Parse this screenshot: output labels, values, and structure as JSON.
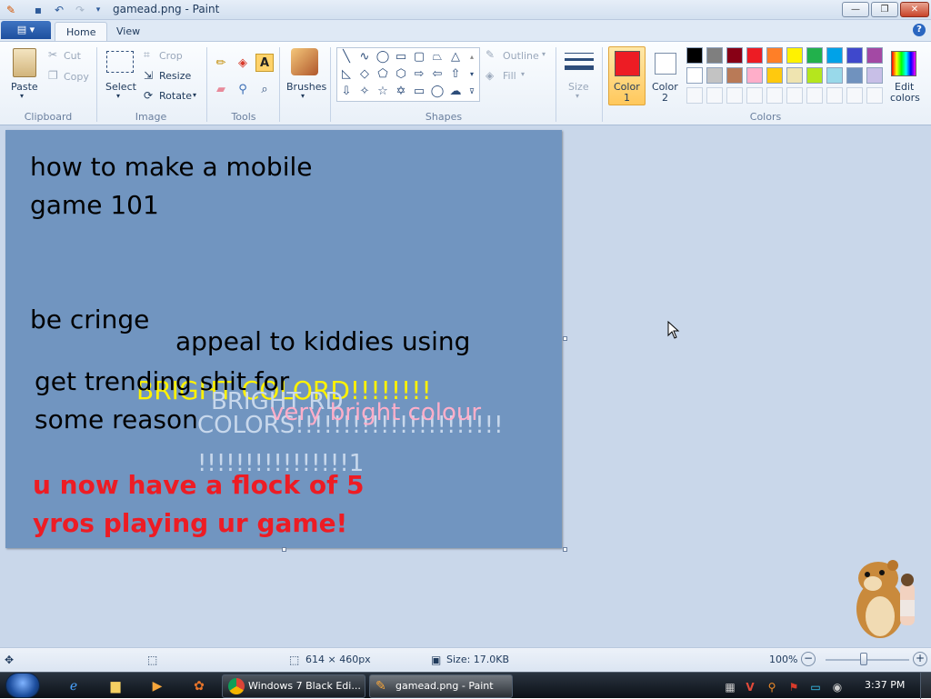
{
  "window": {
    "title": "gamead.png - Paint"
  },
  "quick_access": {
    "save_icon": "save-icon",
    "undo_icon": "undo-icon",
    "redo_icon": "redo-icon"
  },
  "window_buttons": {
    "minimize": "—",
    "maximize": "❐",
    "close": "✕"
  },
  "tabs": [
    {
      "label": "Home"
    },
    {
      "label": "View"
    }
  ],
  "help_label": "?",
  "clipboard": {
    "paste": "Paste",
    "cut": "Cut",
    "copy": "Copy",
    "group": "Clipboard"
  },
  "image": {
    "select": "Select",
    "crop": "Crop",
    "resize": "Resize",
    "rotate": "Rotate",
    "group": "Image"
  },
  "tools": {
    "group": "Tools"
  },
  "brushes": {
    "label": "Brushes"
  },
  "shapes": {
    "outline": "Outline",
    "fill": "Fill",
    "group": "Shapes"
  },
  "size": {
    "label": "Size"
  },
  "colors": {
    "color1_label_a": "Color",
    "color1_label_b": "1",
    "color2_label_a": "Color",
    "color2_label_b": "2",
    "edit_a": "Edit",
    "edit_b": "colors",
    "group": "Colors",
    "color1": "#ed1c24",
    "color2": "#ffffff",
    "palette_row1": [
      "#000000",
      "#7f7f7f",
      "#880015",
      "#ed1c24",
      "#ff7f27",
      "#fff200",
      "#22b14c",
      "#00a2e8",
      "#3f48cc",
      "#a349a4"
    ],
    "palette_row2": [
      "#ffffff",
      "#c3c3c3",
      "#b97a57",
      "#ffaec9",
      "#ffc90e",
      "#efe4b0",
      "#b5e61d",
      "#99d9ea",
      "#7092be",
      "#c8bfe7"
    ]
  },
  "canvas": {
    "background": "#7195c0",
    "lines": [
      {
        "text": "how to make a mobile",
        "color": "#000000"
      },
      {
        "text": "game 101",
        "color": "#000000"
      },
      {
        "text": "be cringe",
        "color": "#000000"
      },
      {
        "text": "appeal to kiddies using",
        "color": "#000000"
      },
      {
        "text": "get trending shit for",
        "color": "#000000"
      },
      {
        "text": "some reason",
        "color": "#000000"
      },
      {
        "text": "BRIGHT COLORD!!!!!!!!",
        "color": "#fff200"
      },
      {
        "text": "BRIGHT RD",
        "color": "#c8d8ec"
      },
      {
        "text": "COLORS!!!!!!!!!!!!!!!!!!!!!!",
        "color": "#c8d8ec"
      },
      {
        "text": "!!!!!!!!!!!!!!!!1",
        "color": "#c8d8ec"
      },
      {
        "text": "very bright colour",
        "color": "#ffaec9"
      },
      {
        "text": "u now have a flock of 5",
        "color": "#ed1c24"
      },
      {
        "text": "yros playing ur game!",
        "color": "#ed1c24"
      }
    ]
  },
  "status": {
    "dimensions": "614 × 460px",
    "size": "Size: 17.0KB",
    "zoom": "100%"
  },
  "taskbar": {
    "tasks": [
      {
        "label": "Windows 7 Black Edi..."
      },
      {
        "label": "gamead.png - Paint"
      }
    ],
    "clock": "3:37 PM"
  }
}
